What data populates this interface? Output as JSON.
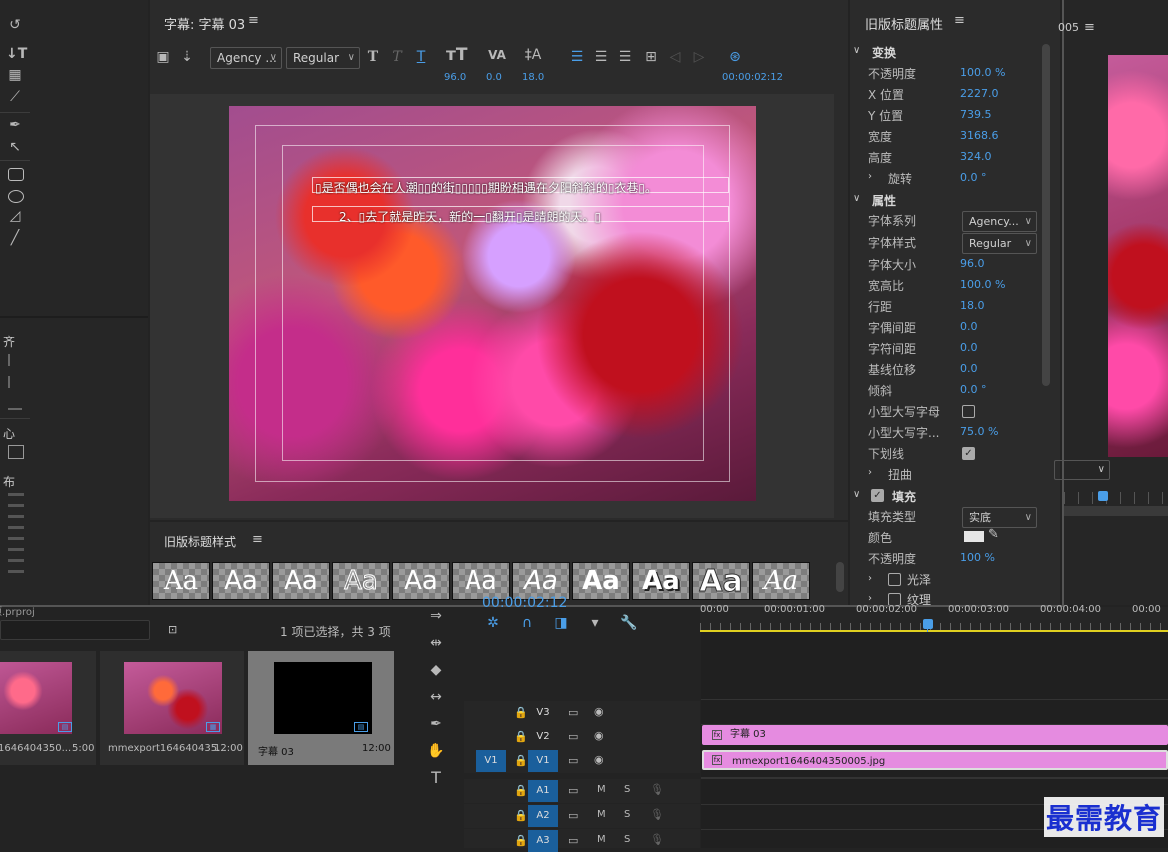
{
  "title_panel": {
    "title": "字幕: 字幕 03",
    "font_family": "Agency ...",
    "font_style": "Regular",
    "toolbar_values": {
      "size": "96.0",
      "kerning": "0.0",
      "leading": "18.0",
      "timecode": "00:00:02:12"
    },
    "subtitle_lines": [
      "▯是否偶也会在人潮▯▯的街▯▯▯▯▯期盼相遇在夕阳斜斜的▯衣巷▯。",
      "2、▯去了就是昨天，新的一▯翻开▯是晴朗的天。▯"
    ]
  },
  "tools": {
    "alignment_label": "齐",
    "center_label": "心",
    "distribute_label": "布"
  },
  "styles_panel": {
    "title": "旧版标题样式",
    "samples": [
      "Aa",
      "Aa",
      "Aa",
      "Aa",
      "Aa",
      "Aa",
      "Aa",
      "Aa",
      "Aa",
      "Aa",
      "Aa"
    ]
  },
  "properties": {
    "title": "旧版标题属性",
    "transform_header": "变换",
    "transform": [
      {
        "label": "不透明度",
        "value": "100.0 %"
      },
      {
        "label": "X 位置",
        "value": "2227.0"
      },
      {
        "label": "Y 位置",
        "value": "739.5"
      },
      {
        "label": "宽度",
        "value": "3168.6"
      },
      {
        "label": "高度",
        "value": "324.0"
      },
      {
        "label": "旋转",
        "value": "0.0 °"
      }
    ],
    "props_header": "属性",
    "font_family_label": "字体系列",
    "font_family_value": "Agency...",
    "font_style_label": "字体样式",
    "font_style_value": "Regular",
    "props": [
      {
        "label": "字体大小",
        "value": "96.0"
      },
      {
        "label": "宽高比",
        "value": "100.0 %"
      },
      {
        "label": "行距",
        "value": "18.0"
      },
      {
        "label": "字偶间距",
        "value": "0.0"
      },
      {
        "label": "字符间距",
        "value": "0.0"
      },
      {
        "label": "基线位移",
        "value": "0.0"
      },
      {
        "label": "倾斜",
        "value": "0.0 °"
      }
    ],
    "small_caps_label": "小型大写字母",
    "small_caps_size_label": "小型大写字...",
    "small_caps_size_value": "75.0 %",
    "underline_label": "下划线",
    "distort_label": "扭曲",
    "fill_header": "填充",
    "fill_type_label": "填充类型",
    "fill_type_value": "实底",
    "color_label": "颜色",
    "fill_opacity_label": "不透明度",
    "fill_opacity_value": "100 %",
    "gloss_label": "光泽",
    "texture_label": "纹理"
  },
  "program_monitor": {
    "title_fragment": "005"
  },
  "project": {
    "name_fragment": "项.prproj",
    "selection_status": "1 项已选择，共 3 项",
    "items": [
      {
        "name": "1646404350...",
        "duration": "5:00"
      },
      {
        "name": "mmexport164640435...",
        "duration": "12:00"
      },
      {
        "name": "字幕 03",
        "duration": "12:00"
      }
    ]
  },
  "timeline": {
    "timecode_partial": "00:00:02:12",
    "ruler": [
      "00:00",
      "00:00:01:00",
      "00:00:02:00",
      "00:00:03:00",
      "00:00:04:00",
      "00:00"
    ],
    "tracks": {
      "video": [
        "V3",
        "V2",
        "V1"
      ],
      "audio": [
        "A1",
        "A2",
        "A3"
      ],
      "source_v": "V1"
    },
    "mute_label": "M",
    "solo_label": "S",
    "clips": [
      {
        "name": "字幕 03",
        "color": "#e58be0"
      },
      {
        "name": "mmexport1646404350005.jpg",
        "color": "#e58be0"
      }
    ]
  },
  "watermark": "最需教育"
}
